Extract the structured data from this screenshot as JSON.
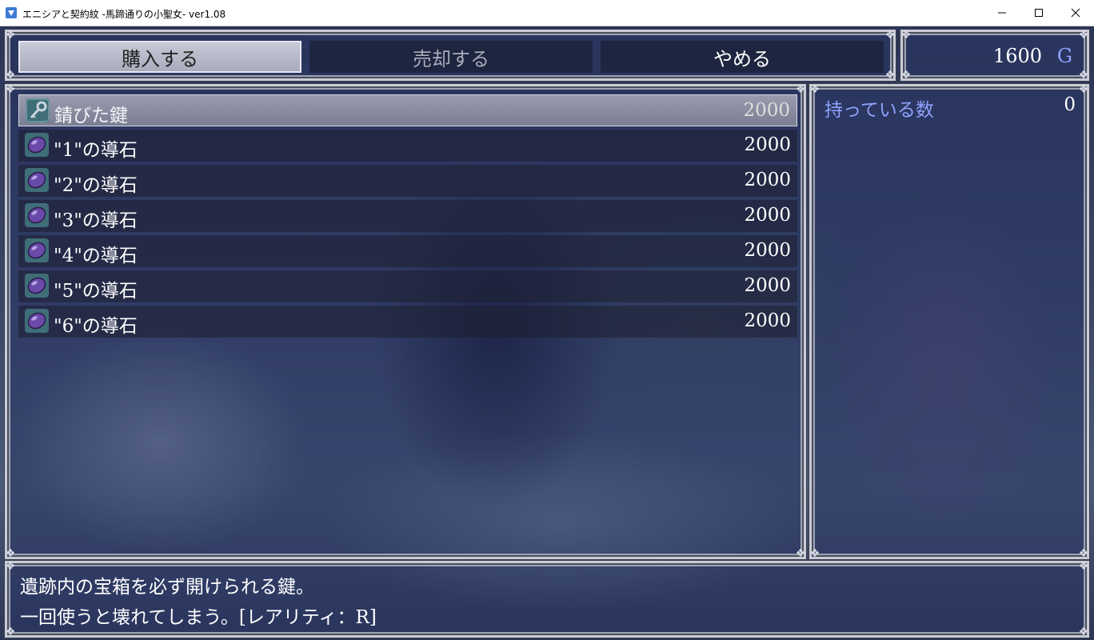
{
  "window": {
    "title": "エニシアと契約紋 -馬蹄通りの小聖女- ver1.08"
  },
  "commands": {
    "buy": "購入する",
    "sell": "売却する",
    "cancel": "やめる"
  },
  "gold": {
    "value": "1600",
    "unit": "G"
  },
  "items": [
    {
      "name": "錆びた鍵",
      "price": "2000",
      "icon": "key-icon",
      "selected": true
    },
    {
      "name": "\"1\"の導石",
      "price": "2000",
      "icon": "purple-stone-icon"
    },
    {
      "name": "\"2\"の導石",
      "price": "2000",
      "icon": "purple-stone-icon"
    },
    {
      "name": "\"3\"の導石",
      "price": "2000",
      "icon": "purple-stone-icon"
    },
    {
      "name": "\"4\"の導石",
      "price": "2000",
      "icon": "purple-stone-icon"
    },
    {
      "name": "\"5\"の導石",
      "price": "2000",
      "icon": "purple-stone-icon"
    },
    {
      "name": "\"6\"の導石",
      "price": "2000",
      "icon": "purple-stone-icon"
    }
  ],
  "status": {
    "possession_label": "持っている数",
    "possession_value": "0"
  },
  "help": {
    "line1": "遺跡内の宝箱を必ず開けられる鍵。",
    "line2": "一回使うと壊れてしまう。[レアリティ：R]"
  },
  "colors": {
    "system_blue": "#8fa2ff",
    "selected_row": "#b4b4c0"
  }
}
